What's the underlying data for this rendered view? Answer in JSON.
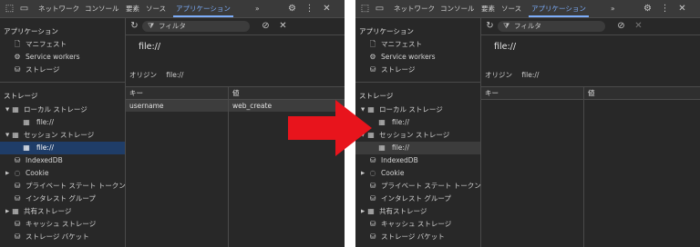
{
  "tabs": [
    "ネットワーク",
    "コンソール",
    "要素",
    "ソース",
    "アプリケーション"
  ],
  "more_tabs": "»",
  "application": {
    "heading": "アプリケーション",
    "items": [
      "マニフェスト",
      "Service workers",
      "ストレージ"
    ]
  },
  "storage": {
    "heading": "ストレージ",
    "local_storage": "ローカル ストレージ",
    "local_file": "file://",
    "session_storage": "セッション ストレージ",
    "session_file": "file://",
    "items": [
      "IndexedDB",
      "Cookie",
      "プライベート ステート トークン",
      "インタレスト グループ",
      "共有ストレージ",
      "キャッシュ ストレージ",
      "ストレージ バケット"
    ]
  },
  "filter": {
    "placeholder": "フィルタ"
  },
  "origin": {
    "title": "file://",
    "label": "オリジン",
    "value": "file://"
  },
  "table": {
    "headers": [
      "キー",
      "値"
    ],
    "rows_before": [
      {
        "key": "username",
        "value": "web_create"
      }
    ],
    "rows_after": []
  },
  "colors": {
    "selected_row": "#1f3d68",
    "accent": "#7cacf8",
    "arrow": "#e8141c"
  }
}
